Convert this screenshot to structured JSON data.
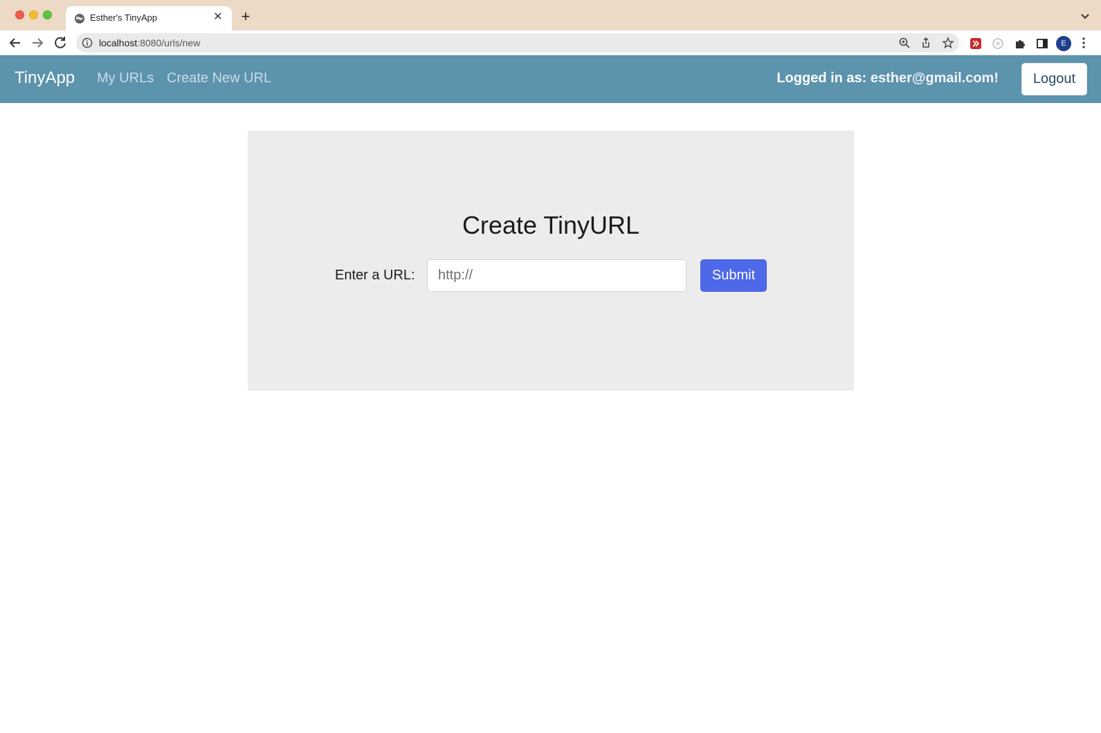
{
  "browser": {
    "tab_title": "Esther's TinyApp",
    "url_host": "localhost",
    "url_path": ":8080/urls/new",
    "profile_initial": "E"
  },
  "navbar": {
    "brand": "TinyApp",
    "links": [
      "My URLs",
      "Create New URL"
    ],
    "logged_in_prefix": "Logged in as:",
    "user_email": "esther@gmail.com!",
    "logout_label": "Logout"
  },
  "form": {
    "title": "Create TinyURL",
    "url_label": "Enter a URL:",
    "url_placeholder": "http://",
    "submit_label": "Submit"
  },
  "colors": {
    "navbar_bg": "#5c93ad",
    "card_bg": "#ececec",
    "submit_bg": "#4d68e8",
    "tabstrip_bg": "#ecdac6"
  }
}
